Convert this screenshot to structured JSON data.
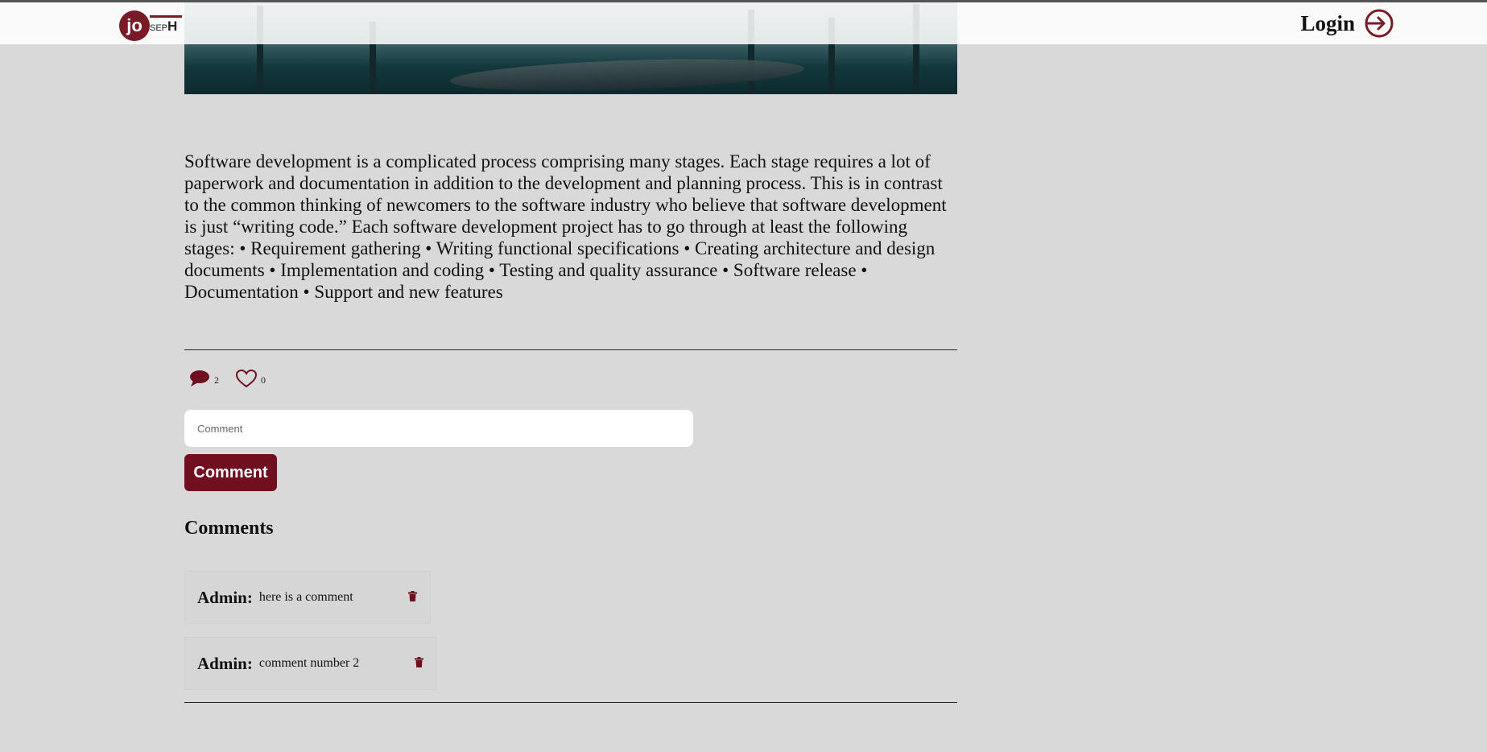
{
  "navbar": {
    "logo": {
      "initials": "jo",
      "middle": "SEP",
      "last": "H"
    },
    "login_label": "Login"
  },
  "article": {
    "body": "Software development is a complicated process comprising many stages. Each stage requires a lot of paperwork and documentation in addition to the development and planning process. This is in contrast to the common thinking of newcomers to the software industry who believe that software development is just “writing code.” Each software development project has to go through at least the following stages: • Requirement gathering • Writing functional specifications • Creating architecture and design documents • Implementation and coding • Testing and quality assurance • Software release • Documentation • Support and new features"
  },
  "stats": {
    "comment_count": "2",
    "like_count": "0"
  },
  "comment_form": {
    "placeholder": "Comment",
    "button_label": "Comment"
  },
  "comments_section": {
    "heading": "Comments",
    "items": [
      {
        "author": "Admin:",
        "text": "here is a comment"
      },
      {
        "author": "Admin:",
        "text": "comment number 2"
      }
    ]
  },
  "colors": {
    "accent": "#6f0f1f",
    "background": "#d9d9d9"
  }
}
